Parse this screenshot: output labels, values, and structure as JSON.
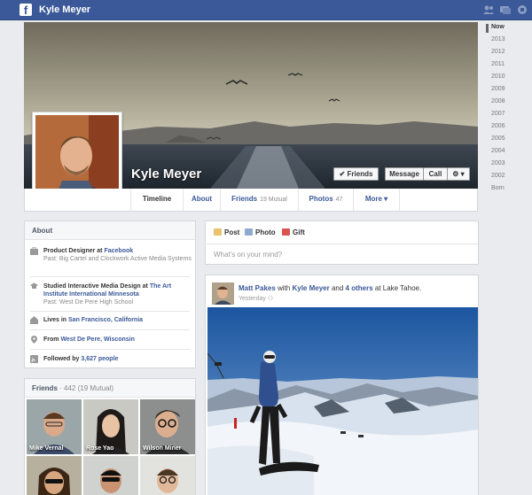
{
  "topbar": {
    "logo_letter": "f",
    "user_name": "Kyle Meyer",
    "icons": [
      "friend-requests-icon",
      "messages-icon",
      "notifications-icon"
    ]
  },
  "timeline_years": [
    "Now",
    "2013",
    "2012",
    "2011",
    "2010",
    "2009",
    "2008",
    "2007",
    "2006",
    "2005",
    "2004",
    "2003",
    "2002",
    "Born"
  ],
  "profile": {
    "name": "Kyle Meyer",
    "buttons": {
      "friends": "Friends",
      "message": "Message",
      "call": "Call",
      "gear": "⚙ ▾"
    },
    "friends_check": "✔"
  },
  "nav": {
    "timeline": "Timeline",
    "about": "About",
    "friends": "Friends",
    "friends_sub": "19 Mutual",
    "photos": "Photos",
    "photos_sub": "47",
    "more": "More",
    "more_arrow": "▾"
  },
  "about": {
    "title": "About",
    "work_main": "Product Designer at ",
    "work_link": "Facebook",
    "work_past": "Past: Big Cartel and Clockwork Active Media Systems",
    "edu_main": "Studied Interactive Media Design at ",
    "edu_link": "The Art Institute International Minnesota",
    "edu_past": "Past: West De Pere High School",
    "lives_main": "Lives in ",
    "lives_link": "San Francisco, California",
    "from_main": "From ",
    "from_link": "West De Pere, Wisconsin",
    "followed_main": "Followed by ",
    "followed_link": "3,627 people"
  },
  "friends_box": {
    "title": "Friends",
    "sub": " · 442 (19 Mutual)",
    "names": [
      "Mike Vernal",
      "Rose Yao",
      "Wilson Miner",
      "",
      "",
      ""
    ]
  },
  "composer": {
    "post": "Post",
    "photo": "Photo",
    "gift": "Gift",
    "placeholder": "What's on your mind?"
  },
  "story": {
    "author": "Matt Pakes",
    "with": " with ",
    "tagged": "Kyle Meyer",
    "and": " and ",
    "others": "4 others",
    "at": " at Lake Tahoe.",
    "time": "Yesterday"
  },
  "colors": {
    "brand": "#3b5998",
    "sky_top": "#1f5fa8",
    "snow": "#f1f4f8"
  }
}
